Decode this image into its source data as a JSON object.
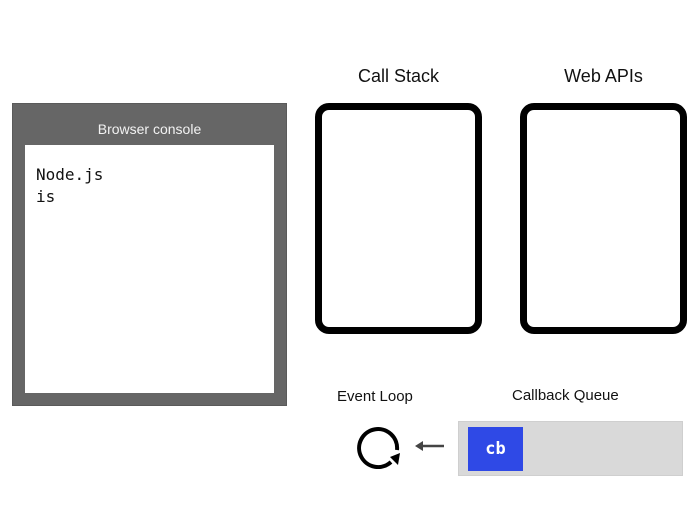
{
  "console": {
    "title": "Browser console",
    "lines": [
      "Node.js",
      "is"
    ]
  },
  "call_stack": {
    "label": "Call Stack"
  },
  "web_apis": {
    "label": "Web APIs"
  },
  "event_loop": {
    "label": "Event Loop",
    "icon": "refresh-loop-icon"
  },
  "callback_queue": {
    "label": "Callback Queue",
    "items": [
      "cb"
    ]
  },
  "colors": {
    "console_frame": "#666666",
    "queue_background": "#d9d9d9",
    "callback_chip": "#2f49e6"
  }
}
